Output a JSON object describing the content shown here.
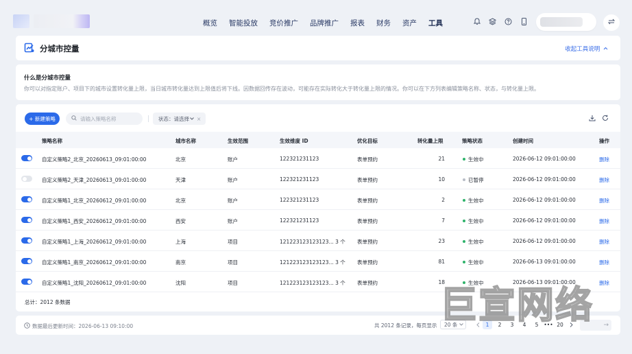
{
  "nav": {
    "items": [
      "概览",
      "智能投放",
      "竞价推广",
      "品牌推广",
      "报表",
      "财务",
      "资产",
      "工具"
    ],
    "active": "工具"
  },
  "header": {
    "title": "分城市控量",
    "collapse_link": "收起工具说明"
  },
  "description": {
    "title": "什么是分城市控量",
    "text": "你可以对指定账户、项目下的城市设置转化量上限，当日城市转化量达到上限值后将下线。因数据回传存在波动，可能存在实际转化大于转化量上限的情况。你可以在下方列表编辑策略名称、状态，与转化量上限。"
  },
  "toolbar": {
    "new_button": "+ 新建策略",
    "search_placeholder": "请输入策略名称",
    "status_filter": "状态：请选择"
  },
  "table": {
    "headers": [
      "策略名称",
      "城市名称",
      "生效范围",
      "生效维度 ID",
      "优化目标",
      "转化量上限",
      "策略状态",
      "创建时间",
      "操作"
    ],
    "rows": [
      {
        "enabled": true,
        "name": "自定义策略2_北京_20260613_09:01:00:00",
        "city": "北京",
        "scope": "账户",
        "dim_id": "122321231123",
        "goal": "表单预约",
        "limit": "21",
        "status": "生效中",
        "created": "2026-06-12 09:01:00:00",
        "action": "删除"
      },
      {
        "enabled": false,
        "name": "自定义策略2_天津_20260613_09:01:00:00",
        "city": "天津",
        "scope": "账户",
        "dim_id": "122321231123",
        "goal": "表单预约",
        "limit": "10",
        "status": "已暂停",
        "created": "2026-06-12 09:01:00:00",
        "action": "删除"
      },
      {
        "enabled": true,
        "name": "自定义策略1_北京_20260612_09:01:00:00",
        "city": "北京",
        "scope": "账户",
        "dim_id": "122321231123",
        "goal": "表单预约",
        "limit": "2",
        "status": "生效中",
        "created": "2026-06-12 09:01:00:00",
        "action": "删除"
      },
      {
        "enabled": true,
        "name": "自定义策略1_西安_20260612_09:01:00:00",
        "city": "西安",
        "scope": "账户",
        "dim_id": "122321231123",
        "goal": "表单预约",
        "limit": "7",
        "status": "生效中",
        "created": "2026-06-12 09:01:00:00",
        "action": "删除"
      },
      {
        "enabled": true,
        "name": "自定义策略1_上海_20260612_09:01:00:00",
        "city": "上海",
        "scope": "项目",
        "dim_id": "121223123123123... 3 个",
        "goal": "表单预约",
        "limit": "23",
        "status": "生效中",
        "created": "2026-06-12 09:01:00:00",
        "action": "删除"
      },
      {
        "enabled": true,
        "name": "自定义策略1_南京_20260612_09:01:00:00",
        "city": "南京",
        "scope": "项目",
        "dim_id": "121223123123123... 3 个",
        "goal": "表单预约",
        "limit": "81",
        "status": "生效中",
        "created": "2026-06-13 09:01:00:00",
        "action": "删除"
      },
      {
        "enabled": true,
        "name": "自定义策略1_沈阳_20260612_09:01:00:00",
        "city": "沈阳",
        "scope": "项目",
        "dim_id": "121223123123123... 3 个",
        "goal": "表单预约",
        "limit": "18",
        "status": "生效中",
        "created": "2026-06-13 09:01:00:00",
        "action": "删除"
      }
    ],
    "total": "总计：2012 条数据"
  },
  "footer": {
    "update_time": "数据最后更新时间：2026-06-13 09:10:00",
    "pager_info": "共 2012 条记录，每页显示",
    "page_size": "20 条",
    "pages": [
      "1",
      "2",
      "3",
      "4",
      "5",
      "•••",
      "20"
    ],
    "current_page": "1"
  },
  "watermark": "巨宣网络",
  "colors": {
    "primary": "#2b6ae9",
    "active_status": "#2fb36b",
    "paused_status": "#b8bdc6",
    "background": "#eef1f6"
  },
  "icons": {
    "title": "chart-report-icon",
    "top": [
      "bell-icon",
      "layers-icon",
      "help-icon",
      "mobile-icon"
    ],
    "switch": "swap-icon",
    "search": "search-icon",
    "download": "download-icon",
    "refresh": "refresh-icon",
    "clock": "clock-icon"
  }
}
